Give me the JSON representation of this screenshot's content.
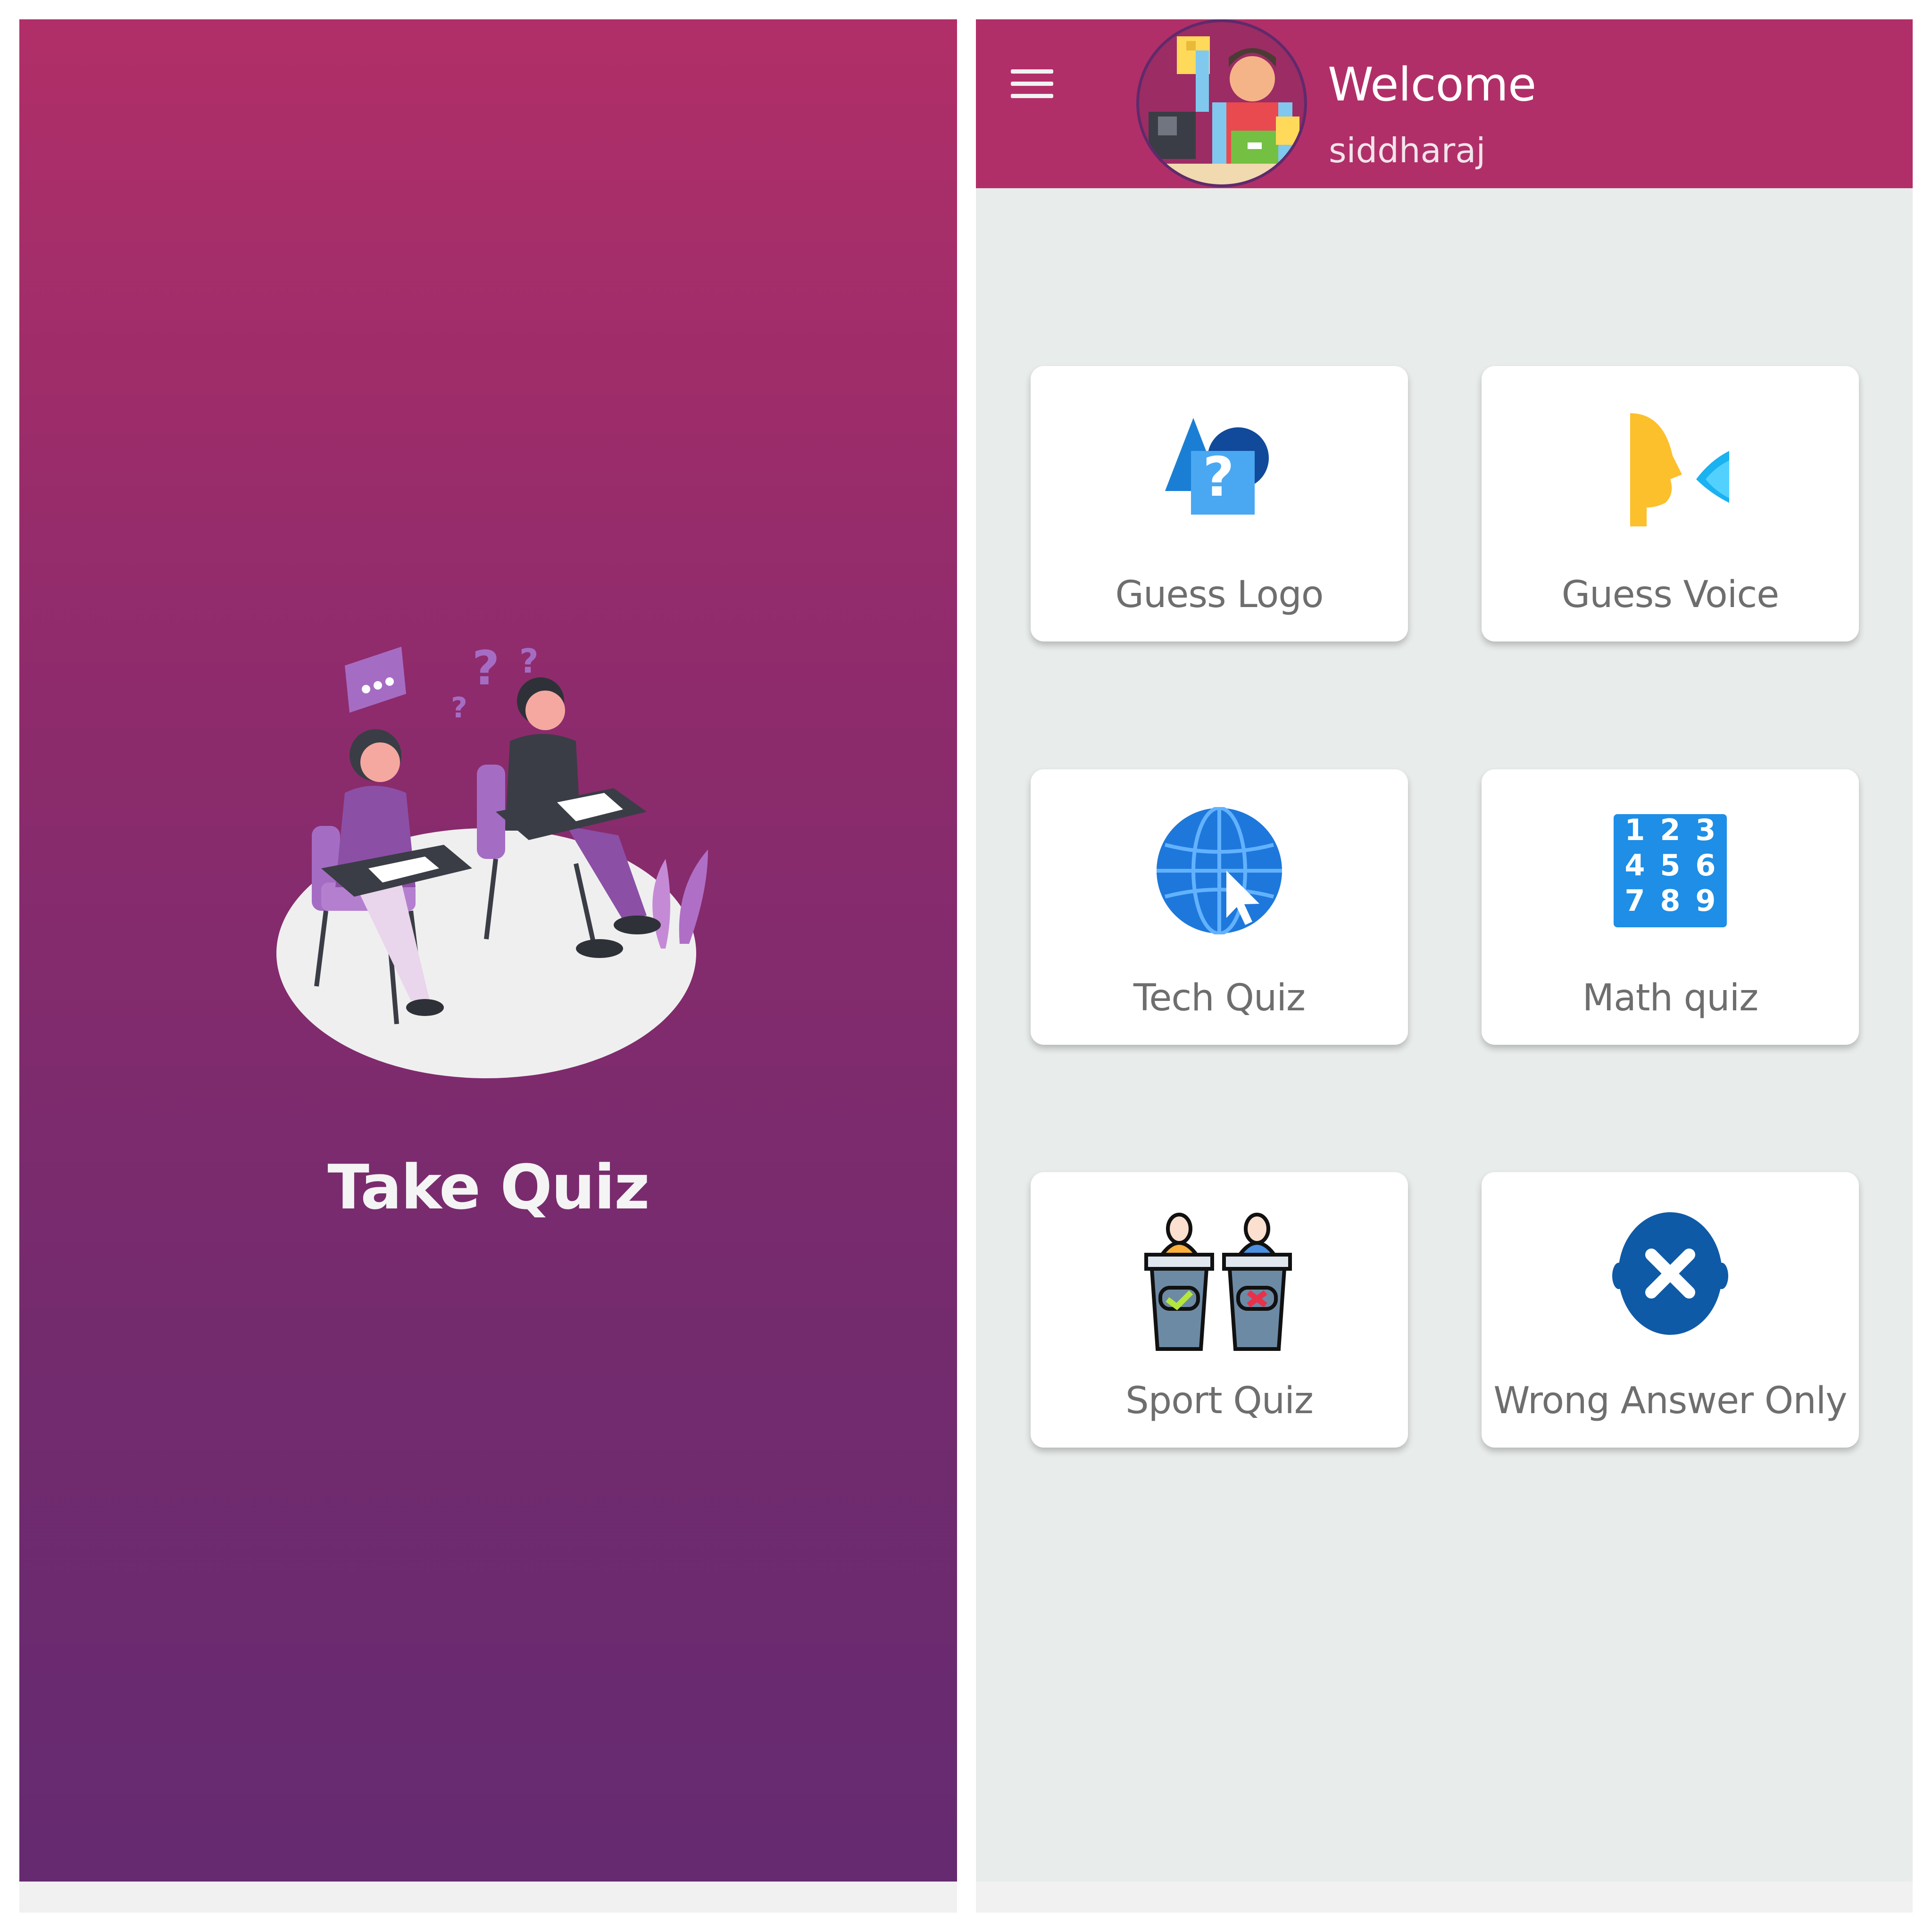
{
  "splash": {
    "title": "Take Quiz",
    "illustration_icon": "students-taking-exam-illustration",
    "gradient_top": "#b12f68",
    "gradient_bottom": "#652a70"
  },
  "dashboard": {
    "header": {
      "welcome": "Welcome",
      "username": "siddharaj",
      "menu_icon": "hamburger-menu-icon",
      "avatar_icon": "shopkeeper-avatar",
      "color": "#b12f68"
    },
    "background": "#e8ecea",
    "cards": [
      {
        "label": "Guess Logo",
        "icon": "logo-question-icon"
      },
      {
        "label": "Guess Voice",
        "icon": "voice-face-icon"
      },
      {
        "label": "Tech Quiz",
        "icon": "globe-cursor-icon"
      },
      {
        "label": "Math quiz",
        "icon": "number-grid-icon",
        "numbers": [
          "1",
          "4",
          "7",
          "2",
          "5",
          "8",
          "3",
          "6",
          "9"
        ]
      },
      {
        "label": "Sport Quiz",
        "icon": "podium-vote-icon"
      },
      {
        "label": "Wrong Answer Only",
        "icon": "wrong-head-icon"
      }
    ]
  }
}
